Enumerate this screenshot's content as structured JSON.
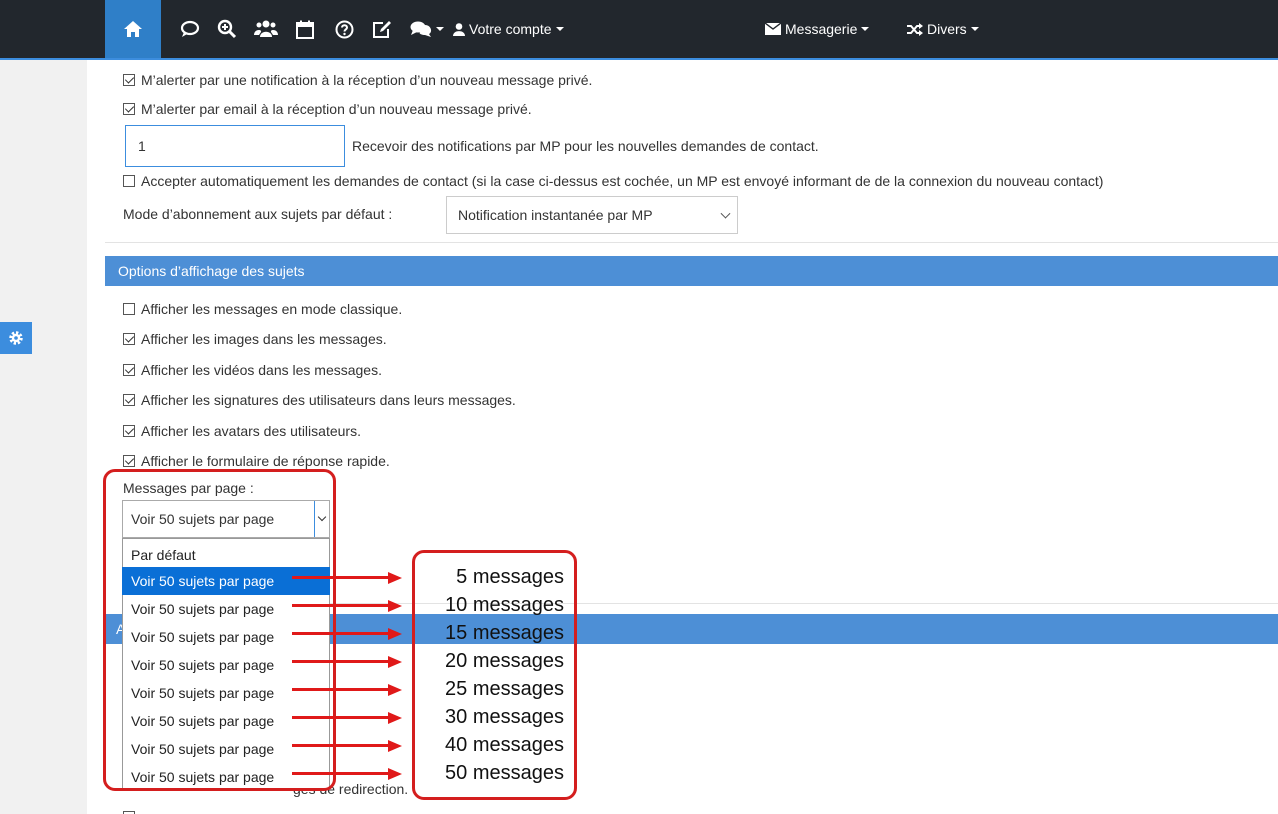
{
  "navbar": {
    "icons": [
      "home-icon",
      "chat-bubble-icon",
      "search-plus-icon",
      "users-icon",
      "calendar-icon",
      "help-circle-icon",
      "edit-icon",
      "comments-icon"
    ],
    "account_label": "Votre compte",
    "messaging_label": "Messagerie",
    "misc_label": "Divers"
  },
  "pm_settings": {
    "notify_pm": "M’alerter par une notification à la réception d’un nouveau message privé.",
    "email_pm": "M’alerter par email à la réception d’un nouveau message privé.",
    "contact_requests_value": "1",
    "contact_requests_label": "Recevoir des notifications par MP pour les nouvelles demandes de contact.",
    "auto_accept": "Accepter automatiquement les demandes de contact (si la case ci-dessus est cochée, un MP est envoyé informant de de la connexion du nouveau contact)",
    "subscription_mode_label": "Mode d’abonnement aux sujets par défaut :",
    "subscription_mode_value": "Notification instantanée par MP"
  },
  "topic_display": {
    "section_title": "Options d’affichage des sujets",
    "options": [
      {
        "label": "Afficher les messages en mode classique.",
        "checked": false
      },
      {
        "label": "Afficher les images dans les messages.",
        "checked": true
      },
      {
        "label": "Afficher les vidéos dans les messages.",
        "checked": true
      },
      {
        "label": "Afficher les signatures des utilisateurs dans leurs messages.",
        "checked": true
      },
      {
        "label": "Afficher les avatars des utilisateurs.",
        "checked": true
      },
      {
        "label": "Afficher le formulaire de réponse rapide.",
        "checked": true
      }
    ],
    "messages_per_page_label": "Messages par page :",
    "messages_per_page_value": "Voir 50 sujets par page",
    "dropdown_options": [
      "Par défaut",
      "Voir 50 sujets par page",
      "Voir 50 sujets par page",
      "Voir 50 sujets par page",
      "Voir 50 sujets par page",
      "Voir 50 sujets par page",
      "Voir 50 sujets par page",
      "Voir 50 sujets par page",
      "Voir 50 sujets par page"
    ],
    "selected_option_index": 1
  },
  "annotations": [
    "5 messages",
    "10 messages",
    "15 messages",
    "20 messages",
    "25 messages",
    "30 messages",
    "40 messages",
    "50 messages"
  ],
  "hidden_section_initial": "A",
  "redirect_partial": "ges de redirection.",
  "colors": {
    "navbar_bg": "#22272d",
    "accent": "#3c8dde",
    "section_bar": "#4d8fd6",
    "selected_option": "#0a6fd6",
    "annotation_red": "#d41e1e"
  }
}
